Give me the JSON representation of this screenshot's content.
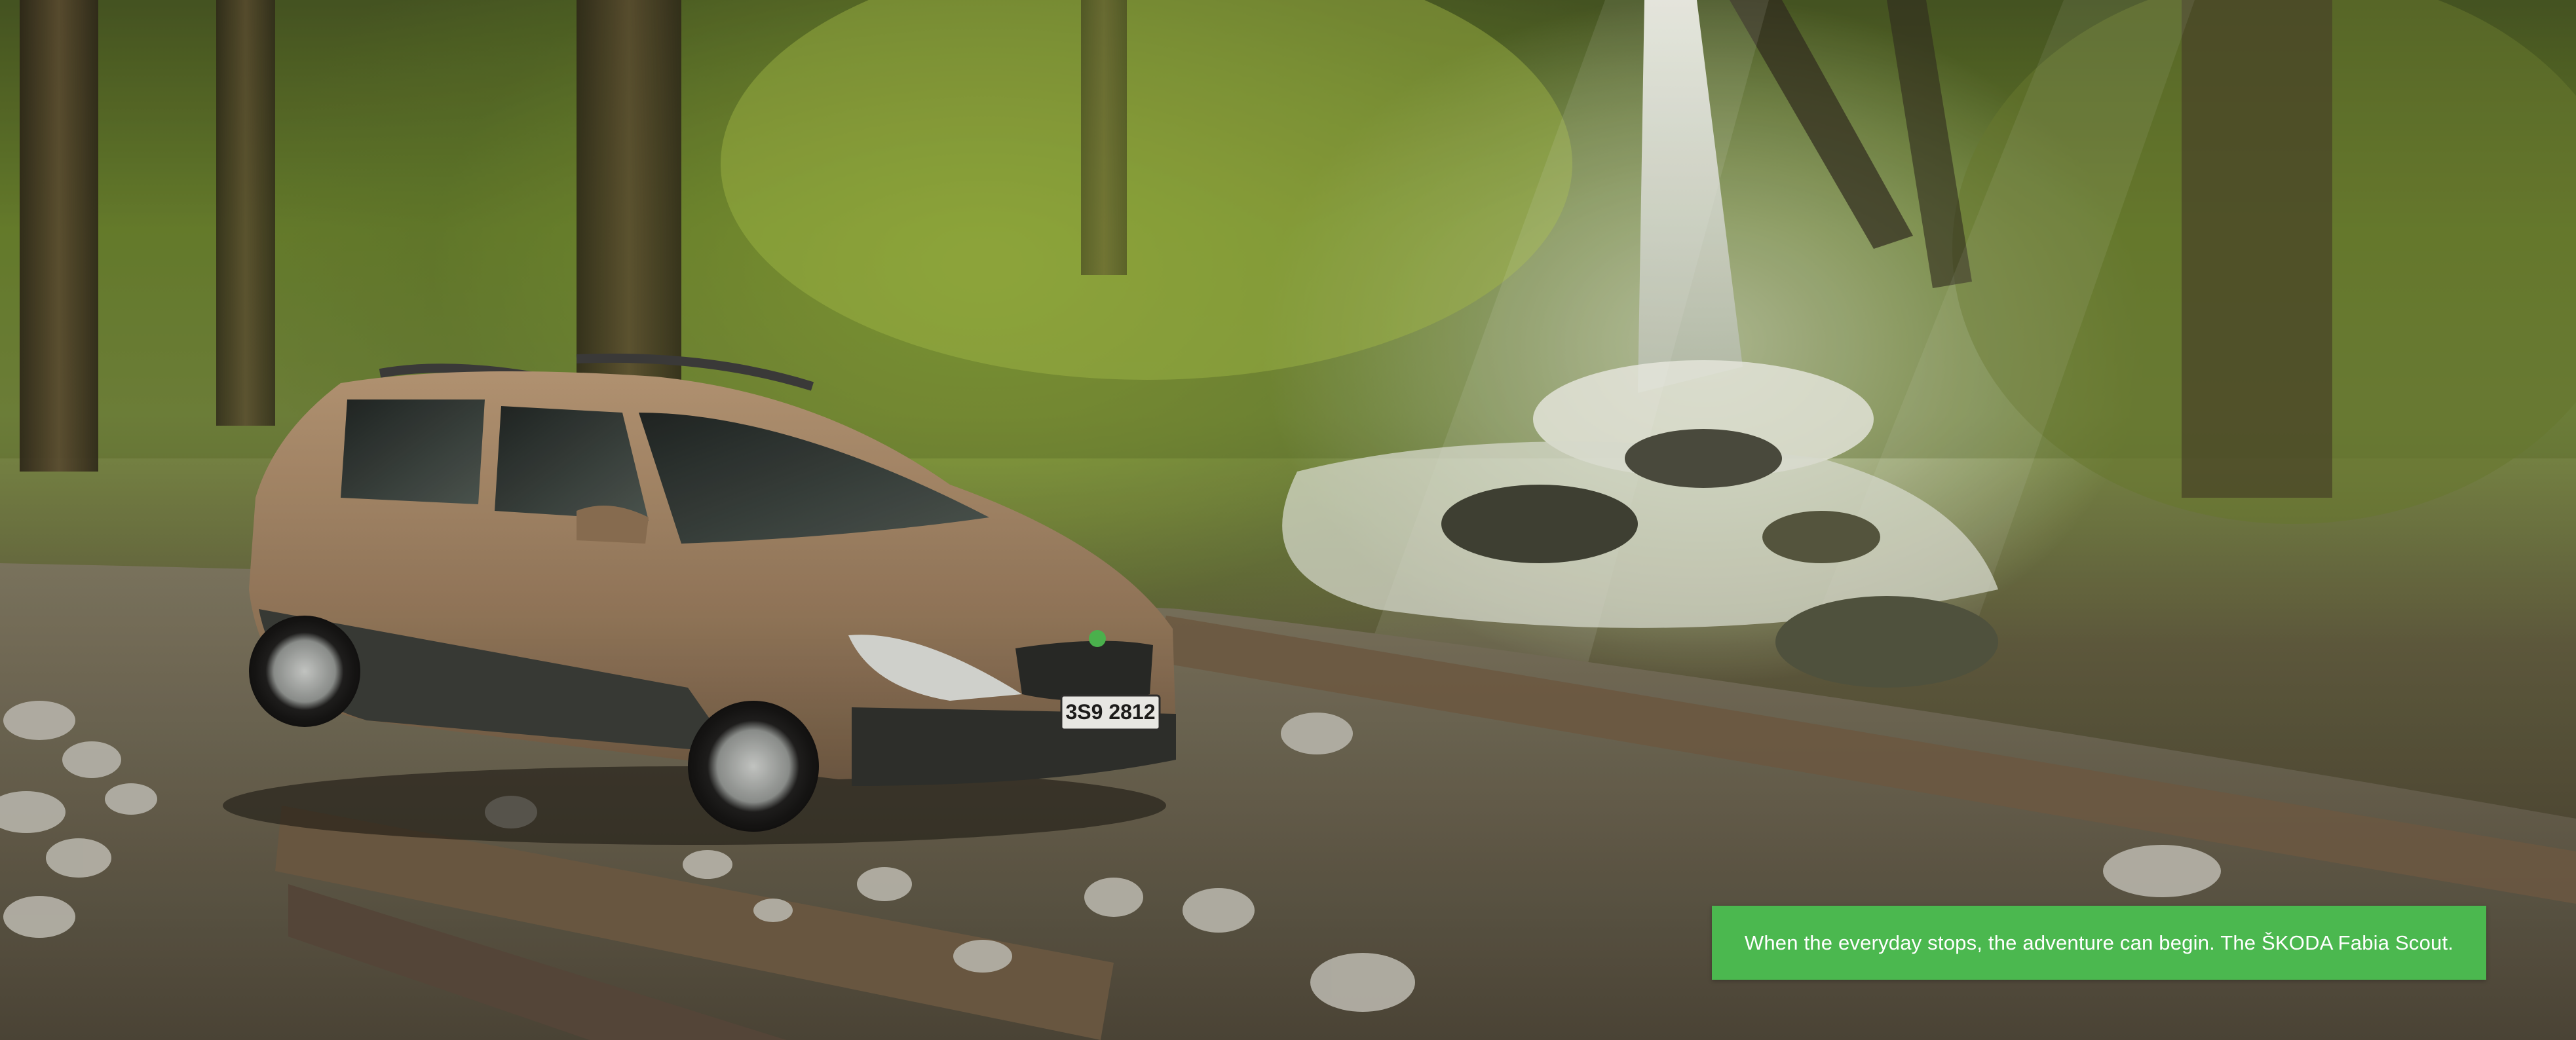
{
  "photo": {
    "description_icon": "forest-car-photo",
    "license_plate": "3S9 2812"
  },
  "caption": {
    "text": "When the everyday stops, the adventure can begin. The ŠKODA Fabia Scout.",
    "background_color": "#4bb84f",
    "text_color": "#ffffff"
  }
}
